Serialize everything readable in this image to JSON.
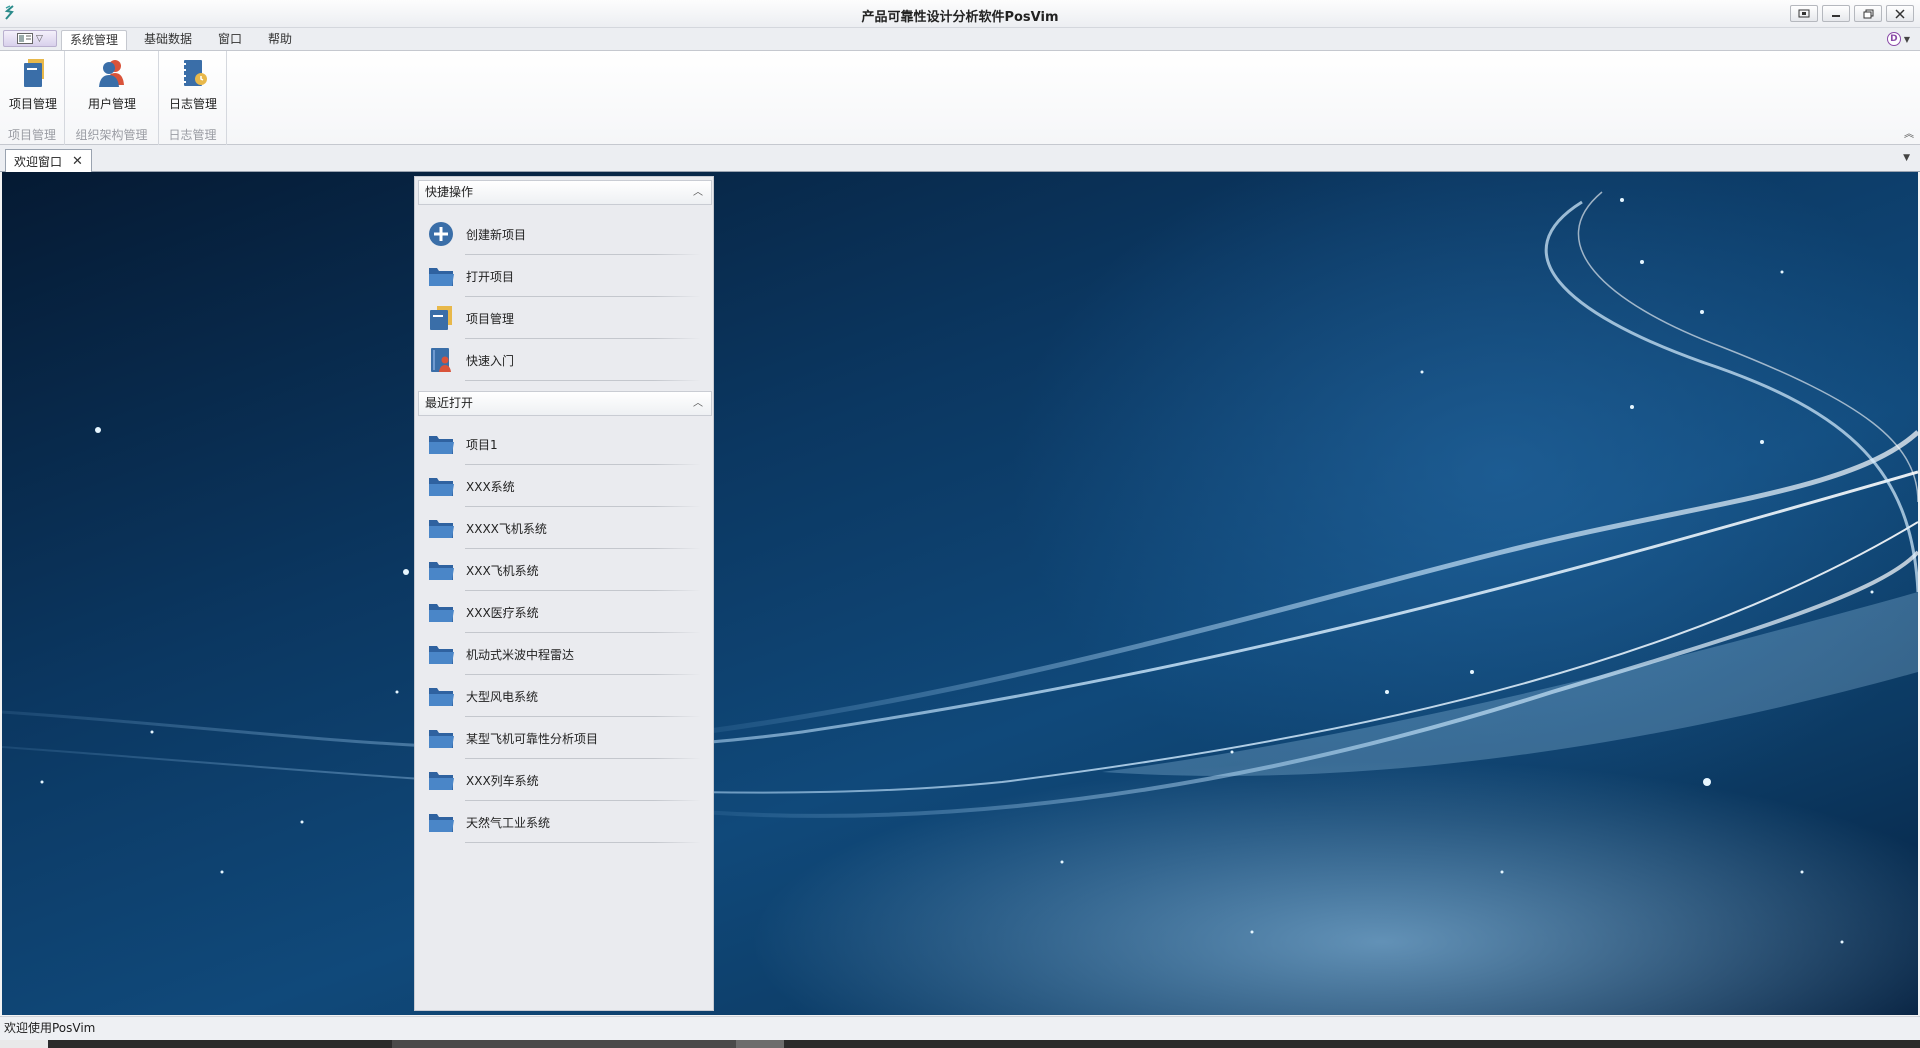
{
  "window": {
    "title": "产品可靠性设计分析软件PosVim"
  },
  "menu": {
    "tabs": [
      "系统管理",
      "基础数据",
      "窗口",
      "帮助"
    ],
    "active_tab": "系统管理"
  },
  "ribbon": {
    "groups": [
      {
        "label": "项目管理",
        "buttons": [
          {
            "label": "项目管理",
            "icon": "project-manage-icon"
          }
        ]
      },
      {
        "label": "组织架构管理",
        "buttons": [
          {
            "label": "用户管理",
            "icon": "user-manage-icon"
          }
        ]
      },
      {
        "label": "日志管理",
        "buttons": [
          {
            "label": "日志管理",
            "icon": "log-manage-icon"
          }
        ]
      }
    ]
  },
  "doc_tabs": [
    {
      "label": "欢迎窗口",
      "closable": true
    }
  ],
  "quick_panel": {
    "quick_ops": {
      "title": "快捷操作",
      "items": [
        {
          "label": "创建新项目",
          "icon": "plus-circle-icon"
        },
        {
          "label": "打开项目",
          "icon": "folder-icon"
        },
        {
          "label": "项目管理",
          "icon": "project-manage-icon"
        },
        {
          "label": "快速入门",
          "icon": "book-user-icon"
        }
      ]
    },
    "recent": {
      "title": "最近打开",
      "items": [
        {
          "label": "项目1"
        },
        {
          "label": "XXX系统"
        },
        {
          "label": "XXXX飞机系统"
        },
        {
          "label": "XXX飞机系统"
        },
        {
          "label": "XXX医疗系统"
        },
        {
          "label": "机动式米波中程雷达"
        },
        {
          "label": "大型风电系统"
        },
        {
          "label": "某型飞机可靠性分析项目"
        },
        {
          "label": "XXX列车系统"
        },
        {
          "label": "天然气工业系统"
        }
      ]
    }
  },
  "status_bar": {
    "text": "欢迎使用PosVim"
  },
  "colors": {
    "accent_blue": "#3a6ea8",
    "folder_blue": "#3f78b8",
    "folder_yellow": "#e8b84a",
    "workspace_bg": "#0b3761"
  }
}
